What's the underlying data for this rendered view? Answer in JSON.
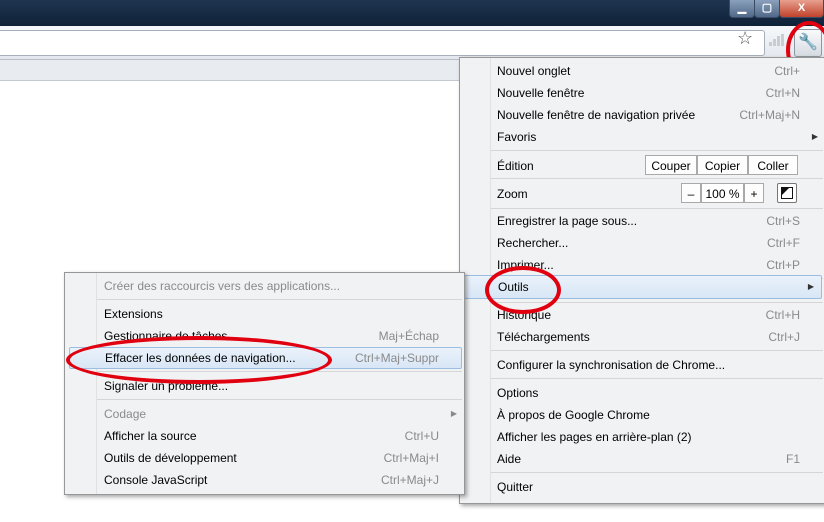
{
  "window": {
    "minimize_symbol": "▁",
    "maximize_symbol": "▢",
    "close_symbol": "X"
  },
  "toolbar": {
    "bookmark_star": "☆",
    "wrench_symbol": "🔧"
  },
  "main_menu": {
    "new_tab": {
      "label": "Nouvel onglet",
      "shortcut": "Ctrl+"
    },
    "new_window": {
      "label": "Nouvelle fenêtre",
      "shortcut": "Ctrl+N"
    },
    "incognito": {
      "label": "Nouvelle fenêtre de navigation privée",
      "shortcut": "Ctrl+Maj+N"
    },
    "favorites": {
      "label": "Favoris"
    },
    "edit": {
      "label": "Édition",
      "cut": "Couper",
      "copy": "Copier",
      "paste": "Coller"
    },
    "zoom": {
      "label": "Zoom",
      "minus": "–",
      "value": "100 %",
      "plus": "+"
    },
    "save_page": {
      "label": "Enregistrer la page sous...",
      "shortcut": "Ctrl+S"
    },
    "find": {
      "label": "Rechercher...",
      "shortcut": "Ctrl+F"
    },
    "print": {
      "label": "Imprimer...",
      "shortcut": "Ctrl+P"
    },
    "tools": {
      "label": "Outils"
    },
    "history": {
      "label": "Historique",
      "shortcut": "Ctrl+H"
    },
    "downloads": {
      "label": "Téléchargements",
      "shortcut": "Ctrl+J"
    },
    "sync": {
      "label": "Configurer la synchronisation de Chrome..."
    },
    "options": {
      "label": "Options"
    },
    "about": {
      "label": "À propos de Google Chrome"
    },
    "background_pages": {
      "label": "Afficher les pages en arrière-plan (2)"
    },
    "help": {
      "label": "Aide",
      "shortcut": "F1"
    },
    "quit": {
      "label": "Quitter"
    }
  },
  "tools_menu": {
    "app_shortcuts": {
      "label": "Créer des raccourcis vers des applications..."
    },
    "extensions": {
      "label": "Extensions"
    },
    "task_manager": {
      "label": "Gestionnaire de tâches",
      "shortcut": "Maj+Échap"
    },
    "clear_data": {
      "label": "Effacer les données de navigation...",
      "shortcut": "Ctrl+Maj+Suppr"
    },
    "report_issue": {
      "label": "Signaler un problème..."
    },
    "encoding": {
      "label": "Codage"
    },
    "view_source": {
      "label": "Afficher la source",
      "shortcut": "Ctrl+U"
    },
    "dev_tools": {
      "label": "Outils de développement",
      "shortcut": "Ctrl+Maj+I"
    },
    "js_console": {
      "label": "Console JavaScript",
      "shortcut": "Ctrl+Maj+J"
    }
  },
  "colors": {
    "highlight_ring": "#e1000f",
    "menu_bg": "#f1f2f4",
    "hover_bg": "#dbe8f6"
  },
  "icons": [
    "minimize-icon",
    "maximize-icon",
    "close-icon",
    "star-icon",
    "signal-icon",
    "wrench-icon",
    "fullscreen-icon",
    "chevron-right-icon"
  ]
}
